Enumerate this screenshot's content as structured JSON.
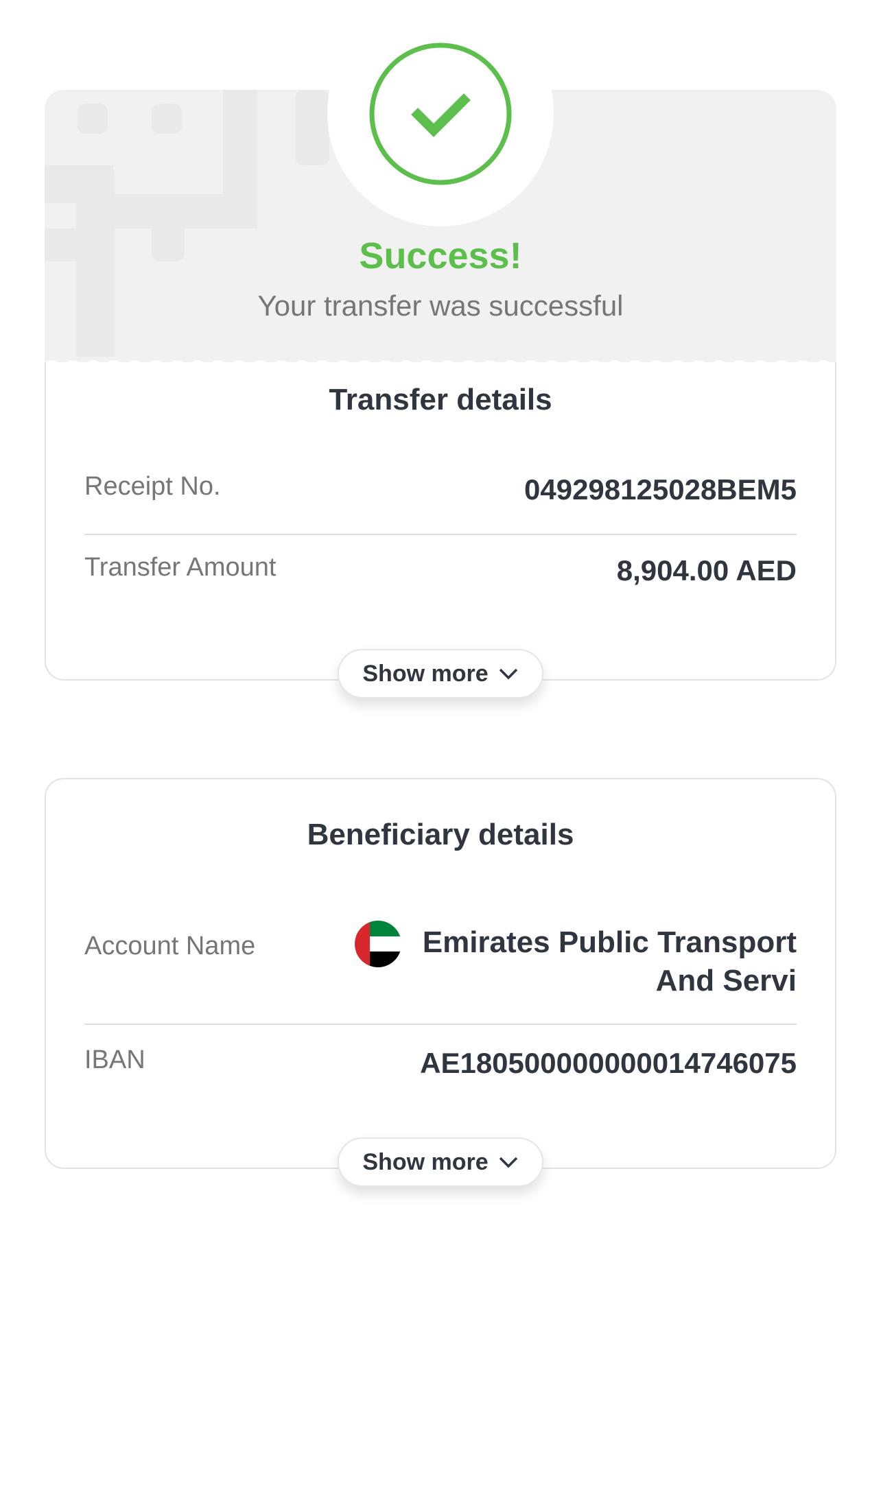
{
  "header": {
    "title": "Success!",
    "subtitle": "Your transfer was successful",
    "icon": "check-circle-icon",
    "accent_color": "#5cbf4b"
  },
  "transfer_details": {
    "title": "Transfer details",
    "rows": [
      {
        "label": "Receipt No.",
        "value": "049298125028BEM5"
      },
      {
        "label": "Transfer Amount",
        "value": "8,904.00 AED"
      }
    ],
    "show_more_label": "Show more"
  },
  "beneficiary_details": {
    "title": "Beneficiary details",
    "account_name_label": "Account Name",
    "account_name_value": "Emirates Public Transport And Servi",
    "flag_icon": "uae-flag-icon",
    "iban_label": "IBAN",
    "iban_value": "AE180500000000014746075",
    "show_more_label": "Show more"
  }
}
